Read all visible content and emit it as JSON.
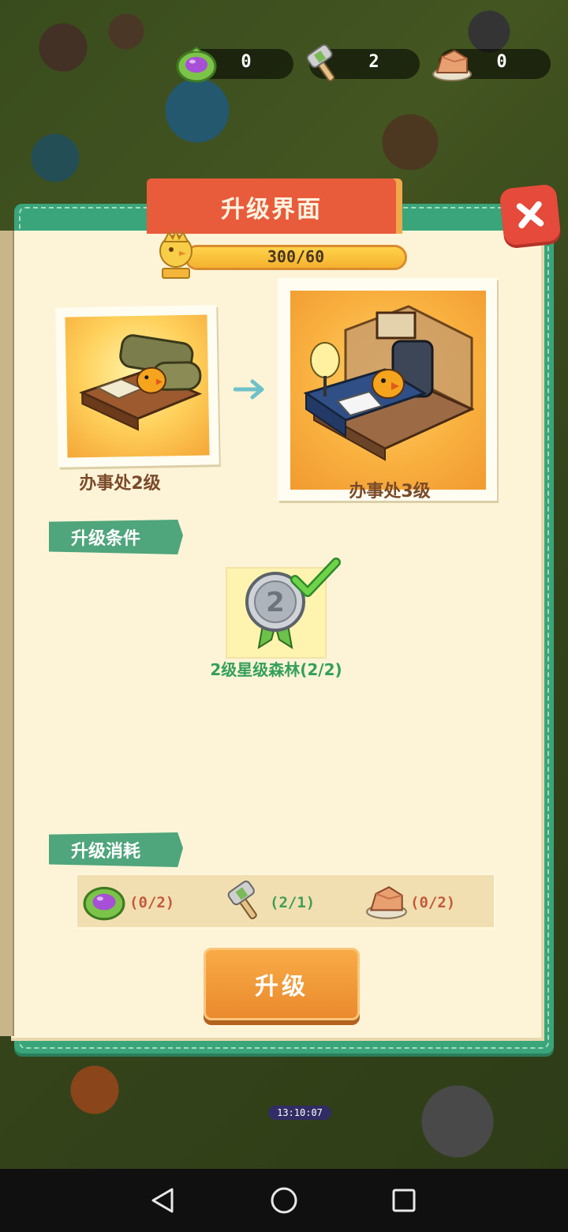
{
  "resources": [
    {
      "icon": "purple-fruit-icon",
      "value": "0"
    },
    {
      "icon": "hammer-icon",
      "value": "2"
    },
    {
      "icon": "stone-icon",
      "value": "0"
    }
  ],
  "panel": {
    "title": "升级界面",
    "progress_text": "300/60",
    "progress_fraction": 1.0
  },
  "current_building": {
    "label": "办事处2级"
  },
  "next_building": {
    "label": "办事处3级"
  },
  "conditions": {
    "header": "升级条件",
    "badge_number": "2",
    "text": "2级星级森林(2/2)",
    "met": true
  },
  "costs": {
    "header": "升级消耗",
    "items": [
      {
        "icon": "purple-fruit-icon",
        "amount": "(0/2)",
        "met": false
      },
      {
        "icon": "hammer-icon",
        "amount": "(2/1)",
        "met": true
      },
      {
        "icon": "stone-icon",
        "amount": "(0/2)",
        "met": false
      }
    ]
  },
  "upgrade_button": {
    "label": "升级"
  },
  "background": {
    "timer": "13:10:07"
  },
  "colors": {
    "accent_red": "#e85c3b",
    "panel_green": "#3aa57a",
    "button_orange": "#f0a040",
    "ok_green": "#3c9f55",
    "need_red": "#c25a3c"
  }
}
